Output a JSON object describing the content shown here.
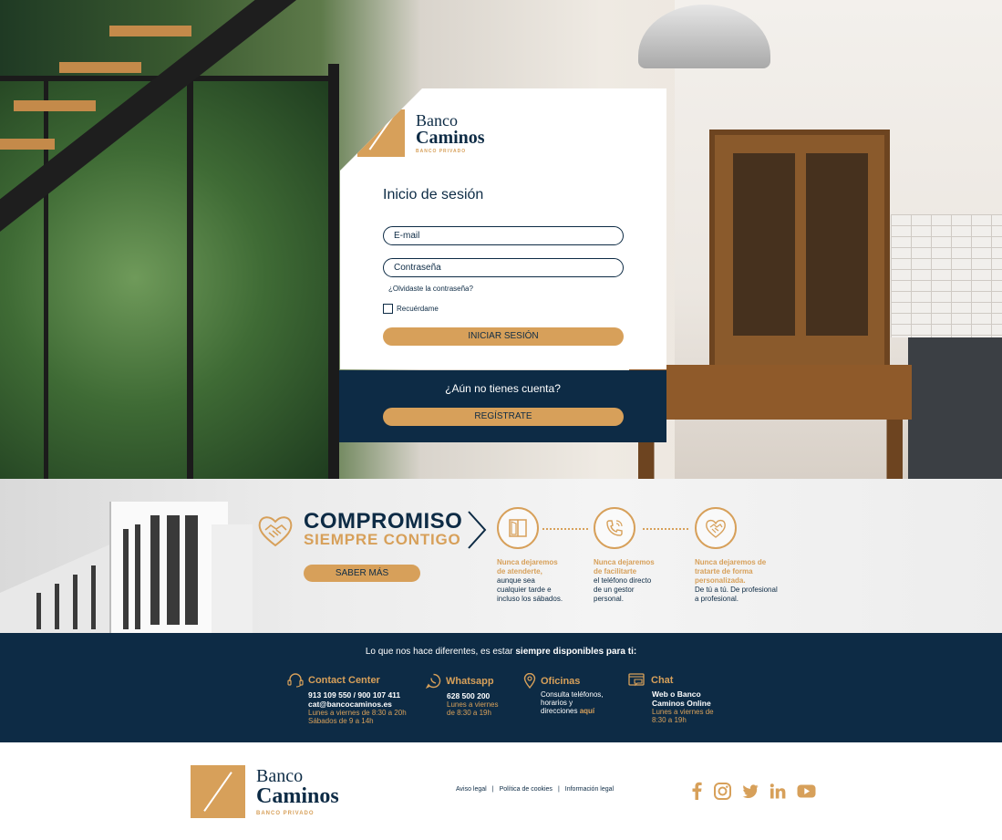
{
  "brand": {
    "name_line1": "Banco",
    "name_line2": "Caminos",
    "tagline": "BANCO PRIVADO",
    "mark": "B/C"
  },
  "colors": {
    "navy": "#0d2b45",
    "gold": "#d7a05a"
  },
  "login": {
    "title": "Inicio de sesión",
    "email_placeholder": "E-mail",
    "password_placeholder": "Contraseña",
    "forgot": "¿Olvidaste la contraseña?",
    "remember": "Recuérdame",
    "submit": "INICIAR SESIÓN"
  },
  "register": {
    "question": "¿Aún no tienes cuenta?",
    "button": "REGÍSTRATE"
  },
  "commitment": {
    "title": "COMPROMISO",
    "subtitle": "SIEMPRE CONTIGO",
    "button": "SABER MÁS",
    "features": [
      {
        "icon": "door-icon",
        "hi1": "Nunca dejaremos",
        "hi2": "de atenderte,",
        "t1": "aunque sea",
        "t2": "cualquier tarde e",
        "t3": "incluso los sábados."
      },
      {
        "icon": "phone-icon",
        "hi1": "Nunca dejaremos",
        "hi2": "de facilitarte",
        "t1": "el teléfono directo",
        "t2": "de un gestor",
        "t3": "personal."
      },
      {
        "icon": "handshake-icon",
        "hi1": "Nunca dejaremos de",
        "hi2": "tratarte de forma",
        "hi3": "personalizada.",
        "t1": "De tú a tú. De profesional",
        "t2": "a profesional."
      }
    ]
  },
  "contact": {
    "intro": "Lo que nos hace diferentes, es estar ",
    "intro_bold": "siempre disponibles para ti:",
    "contact_center": {
      "title": "Contact Center",
      "phones": "913 109 550 / 900 107 411",
      "email": "cat@bancocaminos.es",
      "hours1": "Lunes a viernes de 8:30 a 20h",
      "hours2": "Sábados de 9 a 14h"
    },
    "whatsapp": {
      "title": "Whatsapp",
      "phone": "628 500 200",
      "hours1": "Lunes a viernes",
      "hours2": "de 8:30 a 19h"
    },
    "offices": {
      "title": "Oficinas",
      "l1": "Consulta teléfonos,",
      "l2": "horarios y",
      "l3": "direcciones ",
      "link": "aquí"
    },
    "chat": {
      "title": "Chat",
      "l1": "Web o Banco",
      "l2": "Caminos Online",
      "hours1": "Lunes a viernes de",
      "hours2": "8:30 a 19h"
    }
  },
  "footer": {
    "legal": [
      "Aviso legal",
      "Política de cookies",
      "Información legal"
    ],
    "separator": "|",
    "social": [
      "facebook-icon",
      "instagram-icon",
      "twitter-icon",
      "linkedin-icon",
      "youtube-icon"
    ]
  }
}
